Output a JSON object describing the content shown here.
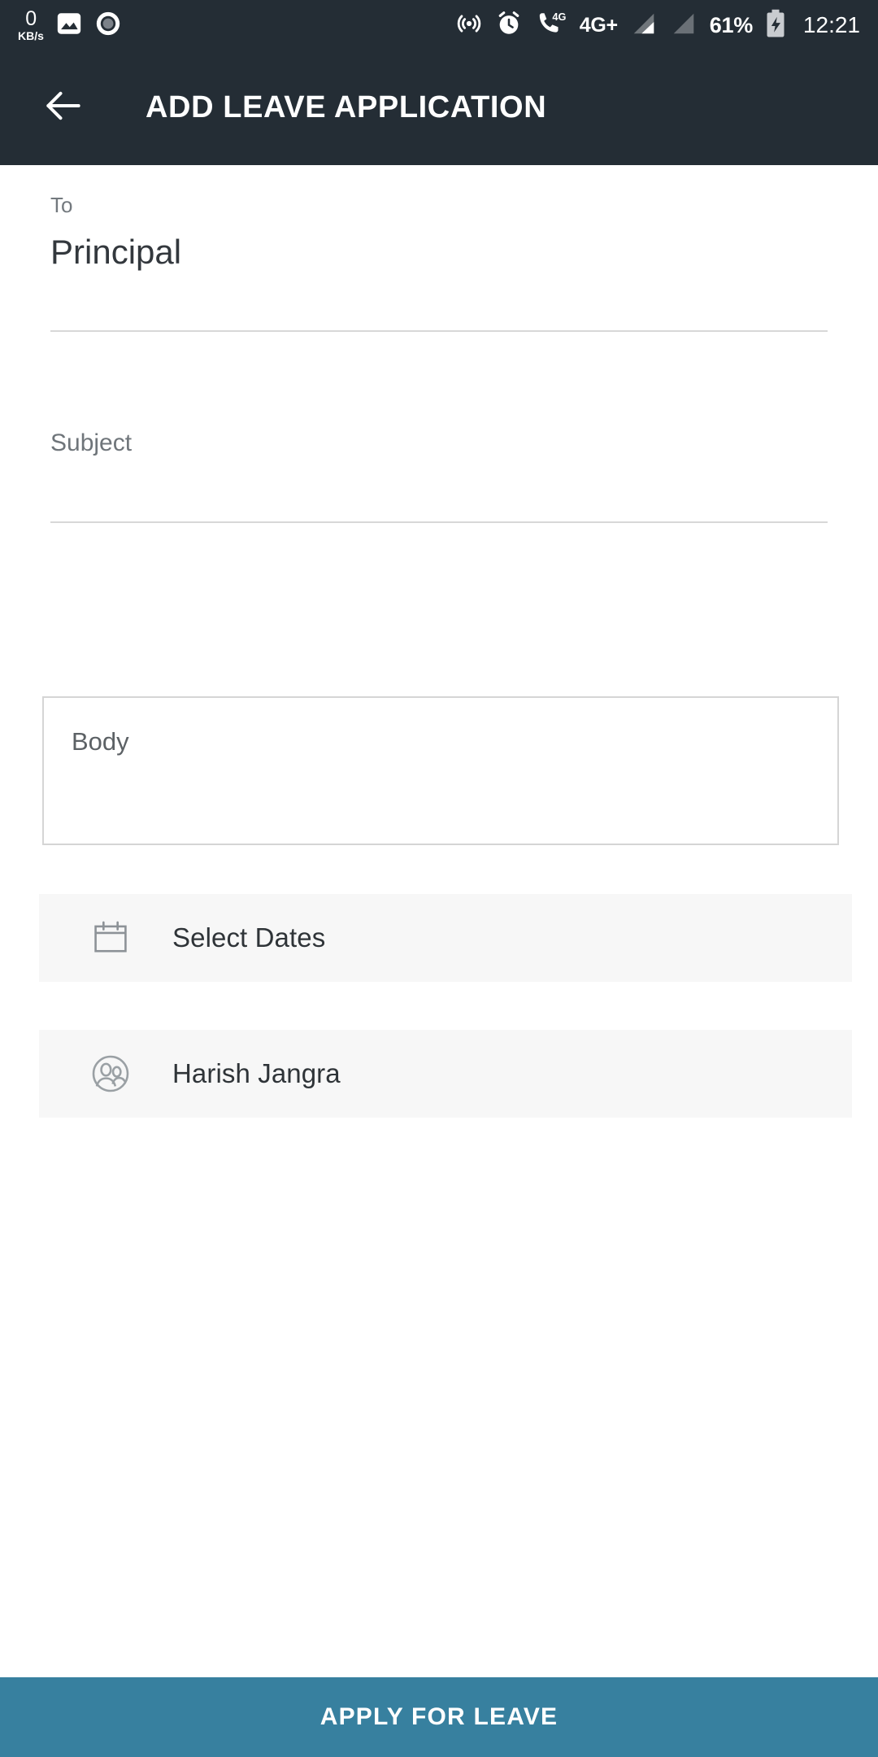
{
  "status_bar": {
    "network_speed_value": "0",
    "network_speed_unit": "KB/s",
    "battery_percent": "61%",
    "time": "12:21",
    "network_type": "4G+",
    "call_network": "4G",
    "icons": [
      "image-icon",
      "record-icon",
      "hotspot-icon",
      "alarm-icon",
      "call-4g-icon",
      "signal-bars-icon",
      "signal-bars-empty-icon",
      "battery-charging-icon"
    ],
    "background_color": "#242d35"
  },
  "app_bar": {
    "title": "ADD LEAVE APPLICATION",
    "back_icon": "arrow-left-icon",
    "background_color": "#242d35"
  },
  "form": {
    "to_field": {
      "label": "To",
      "value": "Principal"
    },
    "subject_field": {
      "placeholder": "Subject",
      "value": ""
    },
    "body_field": {
      "placeholder": "Body",
      "value": ""
    },
    "rows": [
      {
        "label": "Select Dates",
        "icon": "calendar-icon"
      },
      {
        "label": "Harish Jangra",
        "icon": "people-circle-icon"
      }
    ]
  },
  "footer": {
    "apply_label": "APPLY FOR LEAVE",
    "accent_color": "#37809f"
  }
}
